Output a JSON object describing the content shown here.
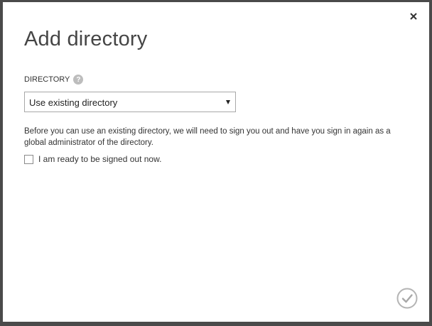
{
  "dialog": {
    "title": "Add directory",
    "close_icon": "close-icon",
    "confirm_icon": "checkmark-circle-icon"
  },
  "directory_field": {
    "label": "DIRECTORY",
    "help_icon_text": "?",
    "selected_value": "Use existing directory"
  },
  "info_text": "Before you can use an existing directory, we will need to sign you out and have you sign in again as a global administrator of the directory.",
  "ready_checkbox": {
    "label": "I am ready to be signed out now.",
    "checked": false
  },
  "colors": {
    "frame": "#4a4a4a",
    "title": "#454545",
    "icon_gray": "#bdbdbd",
    "confirm_gray": "#b4b4b4"
  }
}
